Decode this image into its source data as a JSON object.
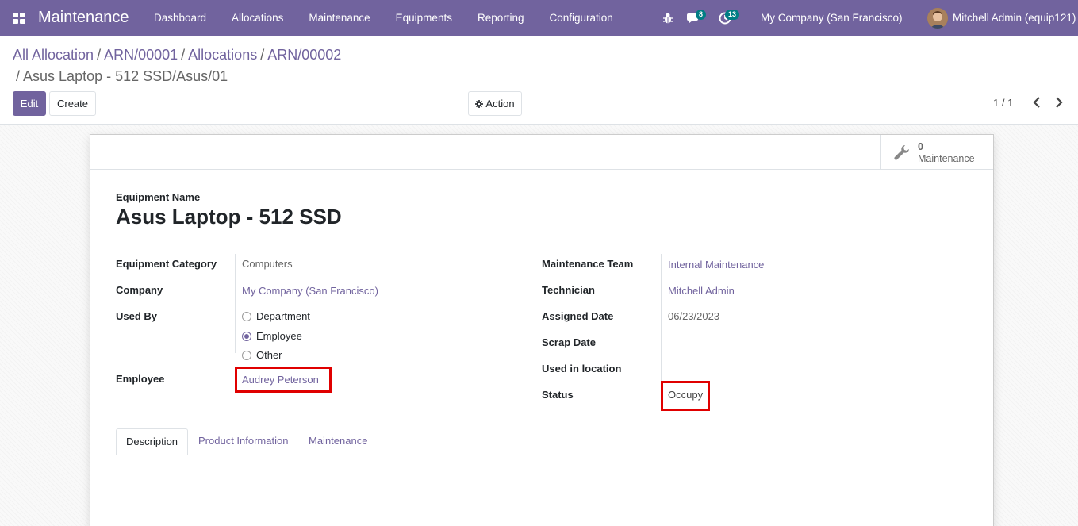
{
  "navbar": {
    "app_title": "Maintenance",
    "menu": [
      "Dashboard",
      "Allocations",
      "Maintenance",
      "Equipments",
      "Reporting",
      "Configuration"
    ],
    "messages_count": "8",
    "activities_count": "13",
    "company": "My Company (San Francisco)",
    "user": "Mitchell Admin (equip121)",
    "colors": {
      "brand": "#71639e",
      "badge": "#017e84"
    }
  },
  "breadcrumb": {
    "items": [
      "All Allocation",
      "ARN/00001",
      "Allocations",
      "ARN/00002"
    ],
    "current": "Asus Laptop - 512 SSD/Asus/01",
    "separator": "/"
  },
  "toolbar": {
    "edit_label": "Edit",
    "create_label": "Create",
    "action_label": "Action",
    "pager": "1 / 1"
  },
  "smart_button": {
    "count": "0",
    "label": "Maintenance"
  },
  "form": {
    "name_label": "Equipment Name",
    "name_value": "Asus Laptop - 512 SSD",
    "left": {
      "category_label": "Equipment Category",
      "category_value": "Computers",
      "company_label": "Company",
      "company_value": "My Company (San Francisco)",
      "used_by_label": "Used By",
      "used_by_options": [
        "Department",
        "Employee",
        "Other"
      ],
      "used_by_selected": "Employee",
      "employee_label": "Employee",
      "employee_value": "Audrey Peterson"
    },
    "right": {
      "team_label": "Maintenance Team",
      "team_value": "Internal Maintenance",
      "technician_label": "Technician",
      "technician_value": "Mitchell Admin",
      "assigned_label": "Assigned Date",
      "assigned_value": "06/23/2023",
      "scrap_label": "Scrap Date",
      "scrap_value": "",
      "location_label": "Used in location",
      "location_value": "",
      "status_label": "Status",
      "status_value": "Occupy"
    }
  },
  "tabs": [
    "Description",
    "Product Information",
    "Maintenance"
  ],
  "active_tab": "Description"
}
